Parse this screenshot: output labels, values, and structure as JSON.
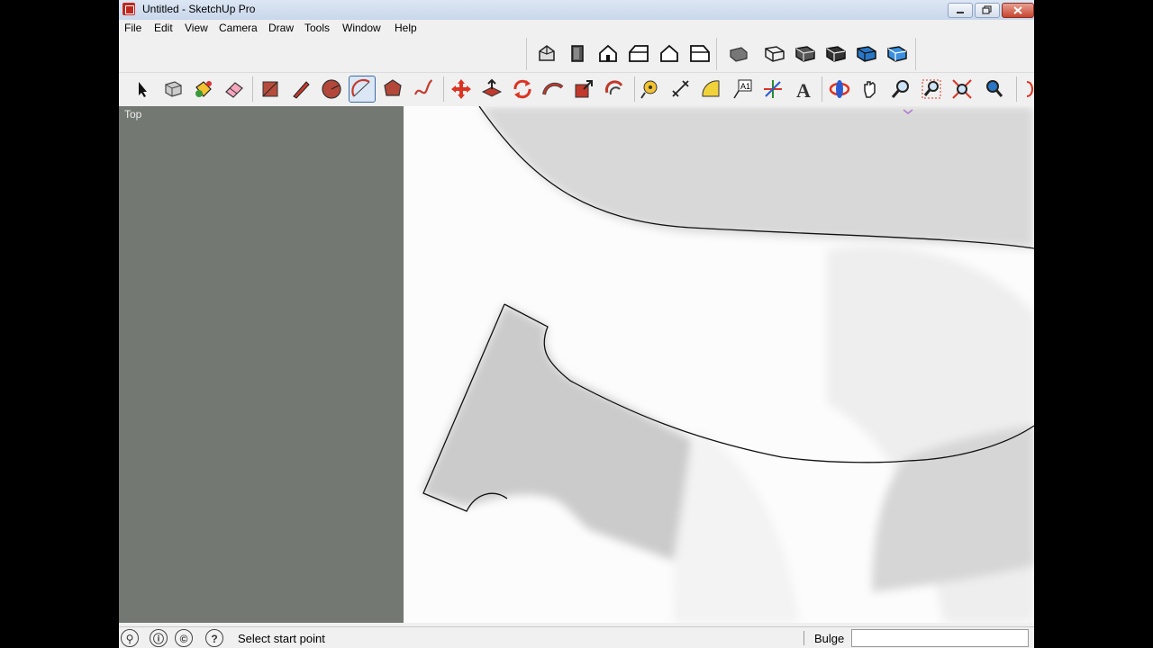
{
  "window": {
    "title": "Untitled - SketchUp Pro",
    "controls": [
      "minimize",
      "maximize",
      "close"
    ]
  },
  "menu": [
    "File",
    "Edit",
    "View",
    "Camera",
    "Draw",
    "Tools",
    "Window",
    "Help"
  ],
  "toolbar_views": [
    "iso-view-icon",
    "top-view-icon",
    "front-view-icon",
    "right-view-icon",
    "back-view-icon",
    "left-view-icon"
  ],
  "toolbar_styles": [
    "xray-icon",
    "wireframe-icon",
    "hidden-line-icon",
    "shaded-icon",
    "shaded-textures-icon",
    "monochrome-icon"
  ],
  "toolbar_main": [
    "select-icon",
    "make-component-icon",
    "paint-bucket-icon",
    "eraser-icon",
    "rectangle-icon",
    "pencil-line-icon",
    "circle-icon",
    "arc-icon",
    "polygon-icon",
    "freehand-icon",
    "move-icon",
    "push-pull-icon",
    "rotate-icon",
    "follow-me-icon",
    "scale-icon",
    "offset-icon",
    "tape-measure-icon",
    "dimension-icon",
    "protractor-icon",
    "text-icon",
    "axes-icon",
    "3d-text-icon",
    "orbit-icon",
    "pan-icon",
    "zoom-icon",
    "zoom-window-icon",
    "zoom-extents-icon",
    "previous-view-icon"
  ],
  "active_tool": "arc-icon",
  "viewport": {
    "view_label": "Top"
  },
  "status": {
    "message": "Select start point",
    "measurement_label": "Bulge",
    "measurement_value": ""
  }
}
